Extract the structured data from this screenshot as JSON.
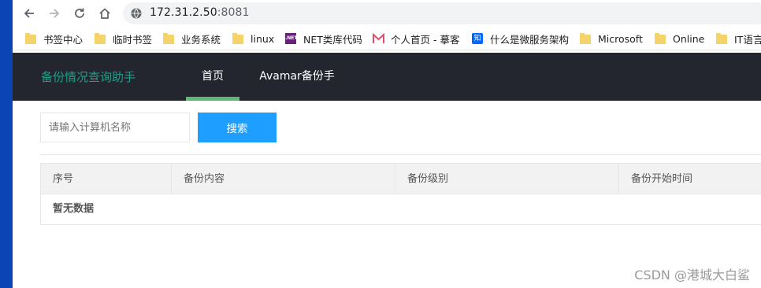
{
  "browser": {
    "url_host": "172.31.2.50",
    "url_port": ":8081"
  },
  "bookmarks": [
    {
      "label": "书签中心",
      "icon": "folder-icon"
    },
    {
      "label": "临时书签",
      "icon": "folder-icon"
    },
    {
      "label": "业务系统",
      "icon": "folder-icon"
    },
    {
      "label": "linux",
      "icon": "folder-icon"
    },
    {
      "label": "NET类库代码",
      "icon": "dotnet-icon"
    },
    {
      "label": "个人首页 - 摹客",
      "icon": "mockplus-icon"
    },
    {
      "label": "什么是微服务架构",
      "icon": "zhihu-icon"
    },
    {
      "label": "Microsoft",
      "icon": "folder-icon"
    },
    {
      "label": "Online",
      "icon": "folder-icon"
    },
    {
      "label": "IT语言",
      "icon": "folder-icon"
    }
  ],
  "app": {
    "logo": "备份情况查询助手",
    "tabs": [
      {
        "label": "首页",
        "active": true
      },
      {
        "label": "Avamar备份手册",
        "active": false
      }
    ]
  },
  "search": {
    "placeholder": "请输入计算机名称",
    "button_label": "搜索"
  },
  "table": {
    "headers": [
      "序号",
      "备份内容",
      "备份级别",
      "备份开始时间"
    ],
    "empty_text": "暂无数据"
  },
  "watermark": "CSDN @港城大白鲨",
  "colors": {
    "header_bg": "#23262e",
    "logo": "#19a08a",
    "tab_indicator": "#5fb878",
    "primary_button": "#1e9fff"
  }
}
